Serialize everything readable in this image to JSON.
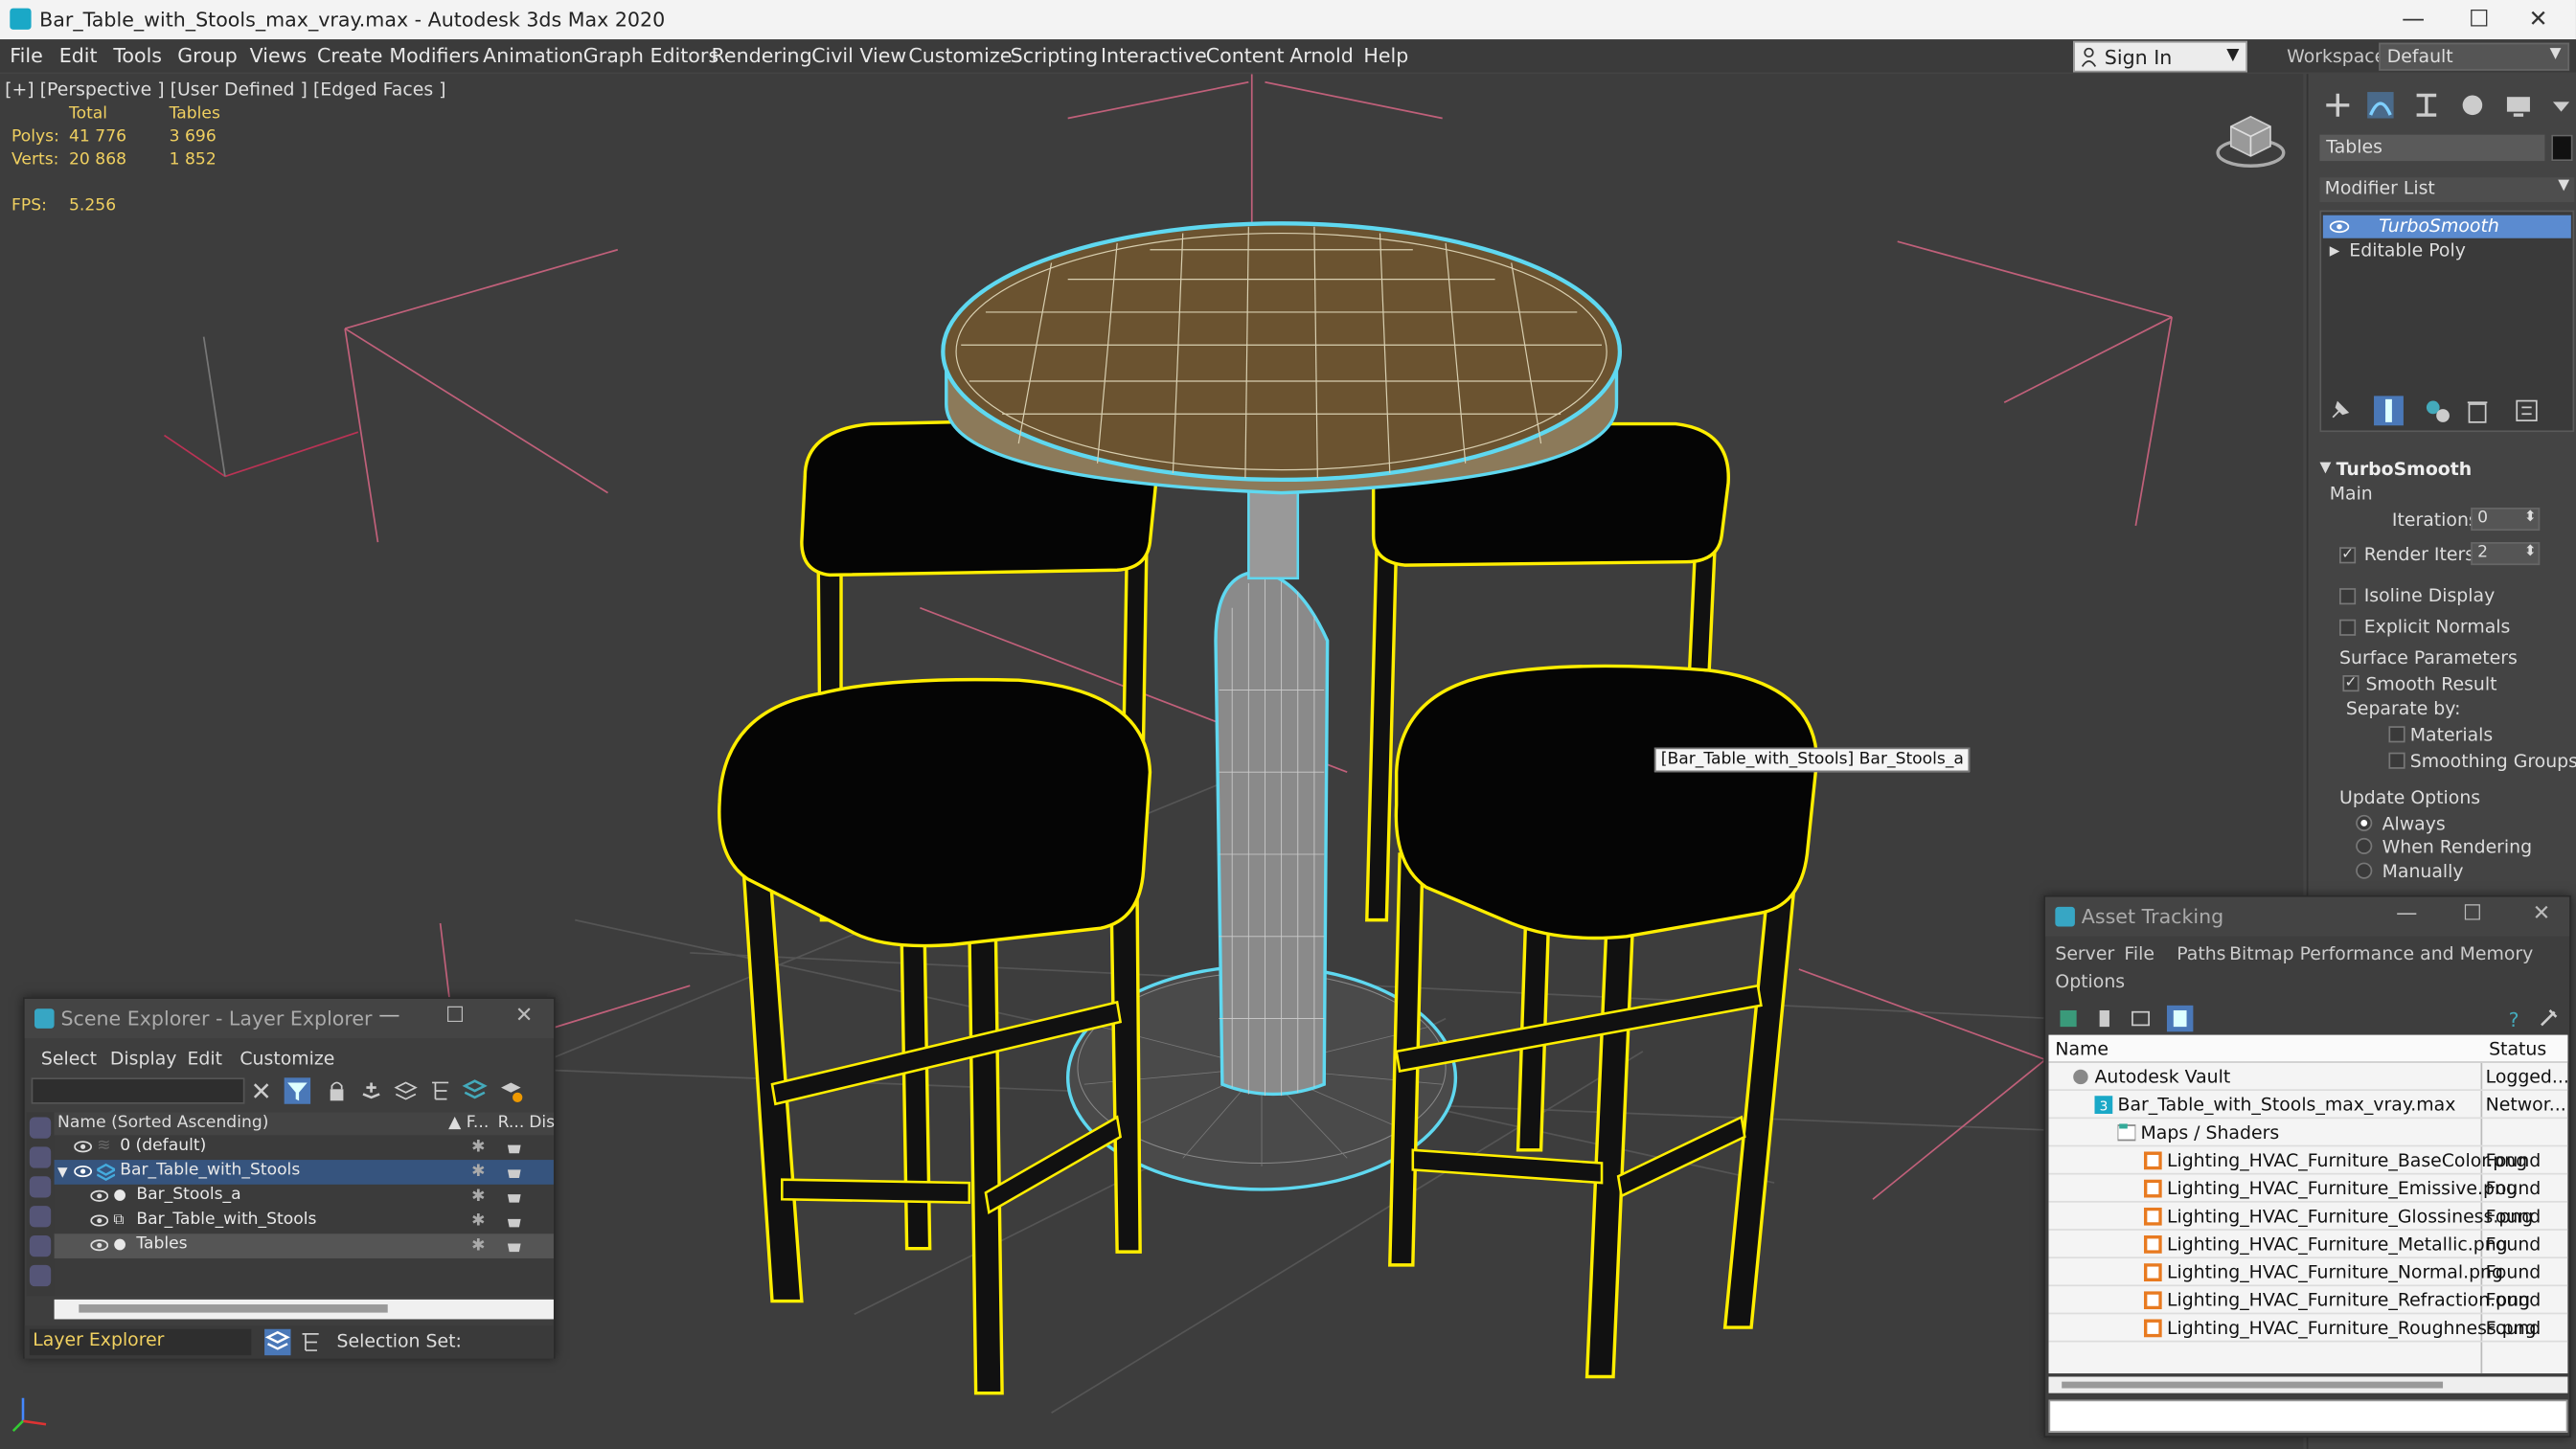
{
  "titlebar": {
    "title": "Bar_Table_with_Stools_max_vray.max - Autodesk 3ds Max 2020",
    "minimize": "—",
    "maximize": "☐",
    "close": "✕"
  },
  "menubar": {
    "items": [
      "File",
      "Edit",
      "Tools",
      "Group",
      "Views",
      "Create",
      "Modifiers",
      "Animation",
      "Graph Editors",
      "Rendering",
      "Civil View",
      "Customize",
      "Scripting",
      "Interactive",
      "Content",
      "Arnold",
      "Help"
    ],
    "signin": "Sign In",
    "workspaces_label": "Workspaces:",
    "workspace_value": "Default"
  },
  "viewport": {
    "label": "[+] [Perspective ] [User Defined ] [Edged Faces ]",
    "stats": {
      "col_total": "Total",
      "col_tables": "Tables",
      "polys_label": "Polys:",
      "polys_total": "41 776",
      "polys_tables": "3 696",
      "verts_label": "Verts:",
      "verts_total": "20 868",
      "verts_tables": "1 852",
      "fps_label": "FPS:",
      "fps_value": "5.256"
    },
    "tooltip": "[Bar_Table_with_Stools] Bar_Stools_a",
    "axis_labels": {
      "z": "z",
      "y": "y",
      "x": "x"
    }
  },
  "command_panel": {
    "object_name": "Tables",
    "modifier_list": "Modifier List",
    "stack": [
      "TurboSmooth",
      "Editable Poly"
    ],
    "rollout": {
      "title": "TurboSmooth",
      "main": "Main",
      "iterations_label": "Iterations:",
      "iterations_value": "0",
      "render_iters_label": "Render Iters:",
      "render_iters_value": "2",
      "isoline_display": "Isoline Display",
      "explicit_normals": "Explicit Normals",
      "surface_parameters": "Surface Parameters",
      "smooth_result": "Smooth Result",
      "separate_by": "Separate by:",
      "materials": "Materials",
      "smoothing_groups": "Smoothing Groups",
      "update_options": "Update Options",
      "always": "Always",
      "when_rendering": "When Rendering",
      "manually": "Manually"
    }
  },
  "scene_explorer": {
    "title": "Scene Explorer - Layer Explorer",
    "menu": [
      "Select",
      "Display",
      "Edit",
      "Customize"
    ],
    "col_name": "Name (Sorted Ascending)",
    "col_f": "▲ F...",
    "col_r": "R...",
    "col_d": "Dis",
    "rows": [
      {
        "name": "0 (default)"
      },
      {
        "name": "Bar_Table_with_Stools"
      },
      {
        "name": "Bar_Stools_a"
      },
      {
        "name": "Bar_Table_with_Stools"
      },
      {
        "name": "Tables"
      }
    ],
    "footer_dropdown": "Layer Explorer",
    "selection_set": "Selection Set:"
  },
  "asset_tracking": {
    "title": "Asset Tracking",
    "menu": [
      "Server",
      "File",
      "Paths",
      "Bitmap Performance and Memory",
      "Options"
    ],
    "col_name": "Name",
    "col_status": "Status",
    "rows": [
      {
        "name": "Autodesk Vault",
        "status": "Logged..."
      },
      {
        "name": "Bar_Table_with_Stools_max_vray.max",
        "status": "Networ..."
      },
      {
        "name": "Maps / Shaders",
        "status": ""
      },
      {
        "name": "Lighting_HVAC_Furniture_BaseColor.png",
        "status": "Found"
      },
      {
        "name": "Lighting_HVAC_Furniture_Emissive.png",
        "status": "Found"
      },
      {
        "name": "Lighting_HVAC_Furniture_Glossiness.png",
        "status": "Found"
      },
      {
        "name": "Lighting_HVAC_Furniture_Metallic.png",
        "status": "Found"
      },
      {
        "name": "Lighting_HVAC_Furniture_Normal.png",
        "status": "Found"
      },
      {
        "name": "Lighting_HVAC_Furniture_Refraction.png",
        "status": "Found"
      },
      {
        "name": "Lighting_HVAC_Furniture_Roughness.png",
        "status": "Found"
      }
    ]
  },
  "colors": {
    "selection_yellow": "#ffee00",
    "selection_cyan": "#5fd8f0",
    "stat_yellow": "#f0d060",
    "viewport_bg": "#3d3d3d",
    "stack_highlight": "#5b8bd0"
  }
}
